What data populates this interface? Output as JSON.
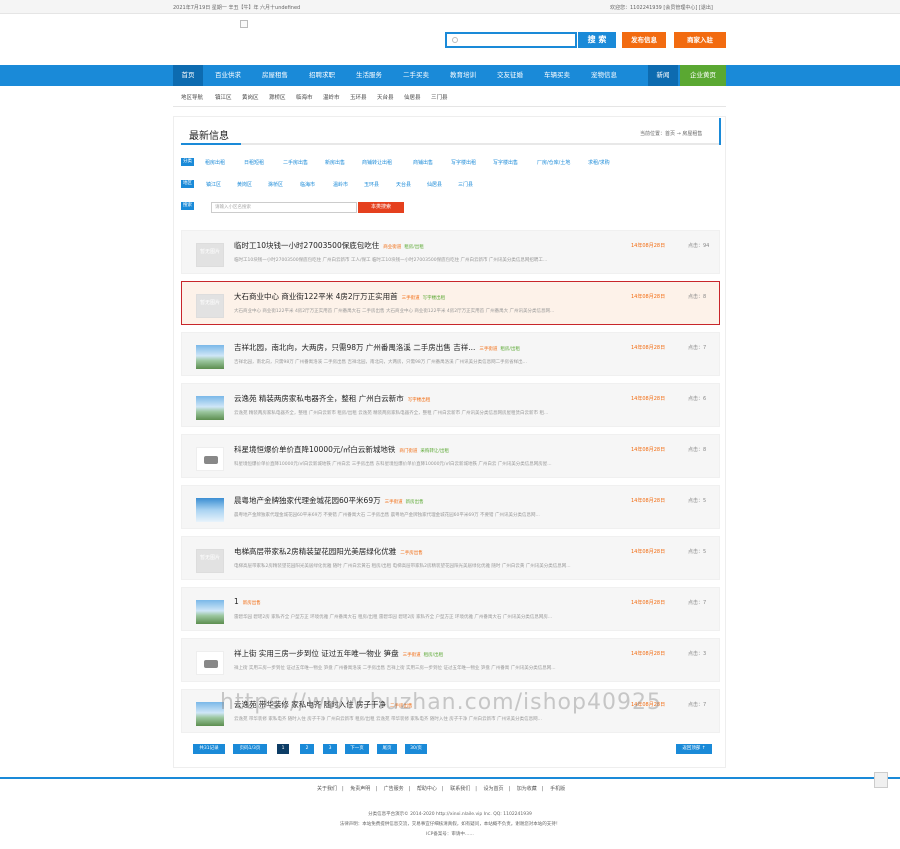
{
  "topbar": {
    "date_text": "2021年7月19日 星期一 辛丑【牛】年 六月十undefined",
    "user_text": "欢迎您：1102241939  [会员管理中心]  [退出]"
  },
  "search": {
    "placeholder": "",
    "button": "搜 索"
  },
  "actions": {
    "post": "发布信息",
    "merchant": "商家入驻"
  },
  "nav": {
    "items": [
      "首页",
      "百业供求",
      "房屋租售",
      "招聘求职",
      "生活服务",
      "二手买卖",
      "教育培训",
      "交友征婚",
      "车辆买卖",
      "宠物信息"
    ],
    "news": "新闻",
    "corp": "企业黄页"
  },
  "subnav": {
    "items": [
      "地区导航",
      "镇江区",
      "黄岗区",
      "滁桥区",
      "临海市",
      "温岭市",
      "玉环县",
      "天台县",
      "仙居县",
      "三门县"
    ]
  },
  "page": {
    "title": "最新信息",
    "breadcrumb": "当前位置：首页 → 房屋租售"
  },
  "filters": {
    "category_label": "分类",
    "categories": [
      "租房出租",
      "日租短租",
      "二手房出售",
      "新房出售",
      "商铺转让出租",
      "商铺出售",
      "写字楼出租",
      "写字楼出售",
      "厂房/仓库/土地",
      "求租/求购"
    ],
    "area_label": "地区",
    "areas": [
      "镇江区",
      "黄岗区",
      "滁桥区",
      "临海市",
      "温岭市",
      "玉环县",
      "天台县",
      "仙居县",
      "三门县"
    ],
    "search_label": "搜索",
    "keyword_placeholder": "请输入小区名搜索",
    "search_button": "本类搜索"
  },
  "listings": [
    {
      "title": "临时工10块钱一小时27003500保底包吃住",
      "tag1": "商业街道",
      "tag2": "租房/出租",
      "desc": "临时工10块钱一小时27003500保底包吃住 广州白云新市 工人/保工 临时工10块钱一小时27003500保底包吃住 广州白云新市 广州讯美分类信息网招聘工...",
      "date": "14年08月28日",
      "hits": "点击：94",
      "thumb": "noimg",
      "noimg_text": "暂无图片"
    },
    {
      "title": "大石商业中心 商业街122平米 4房2厅万正实用首",
      "tag1": "三手街道",
      "tag2": "写字楼出租",
      "desc": "大石商业中心 商业街122平米 4房2厅万正实用首 广州番禺大石 二手房出售 大石商业中心 商业街122平米 4房2厅万正实用首 广州番禺大 广州讯美分类信息网...",
      "date": "14年08月28日",
      "hits": "点击：8",
      "thumb": "noimg",
      "noimg_text": "暂无图片"
    },
    {
      "title": "吉祥北园，南北向，大两房，只需98万 广州番禺洛溪 二手房出售 吉祥...",
      "tag1": "三手街道",
      "tag2": "租房/出租",
      "desc": "吉祥北园，南北向，只需98万 广州番禺洛溪 二手房出售 吉祥北园，南北向，大两房，只需98万 广州番禺洛溪 广州讯美分类信息网二手房省样出...",
      "date": "14年08月28日",
      "hits": "点击：7",
      "thumb": "building"
    },
    {
      "title": "云逸苑 精装两房家私电器齐全，整租 广州白云新市",
      "tag1": "写字楼出租",
      "tag2": "",
      "desc": "云逸苑 精装两房家私电器齐全，整租 广州白云新市 租房/出租 云逸苑 精装两房家私电器齐全，整租 广州白云新市 广州讯美分类信息网房屋租赁白云新市 租...",
      "date": "14年08月28日",
      "hits": "点击：6",
      "thumb": "building"
    },
    {
      "title": "科星境恒爆价单价直降10000元/㎡白云新城地铁",
      "tag1": "商门街道",
      "tag2": "采购转让/出租",
      "desc": "科星境恒爆价单价直降10000元/㎡白云新城地铁 广州白云 三手房出售 东科星境恒爆价单价直降10000元/㎡白云新城地铁 广州白云 广州讯美分类信息网房屋...",
      "date": "14年08月28日",
      "hits": "点击：8",
      "thumb": "cam"
    },
    {
      "title": "晨粤地产金牌独家代理金城花园60平米69万",
      "tag1": "三手街道",
      "tag2": "新房出售",
      "desc": "晨粤地产金牌独家代理金城花园60平米69万 不要错 广州番禺大石 二手房出售 晨粤地产金牌独家代理金城花园60平米69万 不要错 广州讯美分类信息网...",
      "date": "14年08月28日",
      "hits": "点击：5",
      "thumb": "tower"
    },
    {
      "title": "电梯高层带家私2房精装望花园阳光美居绿化优雅",
      "tag1": "二手房出售",
      "tag2": "",
      "desc": "电梯高层带家私2房精装望花园阳光美居绿化优雅 随时 广州白云黄石 租房/出租 电梯高层带家私2房精装望花园阳光美居绿化优雅 随时 广州白云黄 广州讯美分类信息网...",
      "date": "14年08月28日",
      "hits": "点击：5",
      "thumb": "noimg",
      "noimg_text": "暂无图片"
    },
    {
      "title": "1",
      "tag1": "新房出售",
      "tag2": "",
      "desc": "雷碧华园 碧瑶2房 家私齐全 户型方正 环境优雅 广州番禺大石 租房/出租 雷碧华园 碧瑶2房 家私齐全 户型方正 环境优雅 广州番禺大石 广州讯美分类信息网房...",
      "date": "14年08月28日",
      "hits": "点击：7",
      "thumb": "building"
    },
    {
      "title": "祥上街 实用三房一步到位 证过五年唯一物业 笋盘",
      "tag1": "三手街道",
      "tag2": "租房/出租",
      "desc": "祥上街 实用三房一步到位 证过五年唯一物业 笋盘 广州番禺洛溪 二手房出售 吉祥上街 实用三房一步到位 证过五年唯一物业 笋盘 广州番禺 广州讯美分类信息网...",
      "date": "14年08月28日",
      "hits": "点击：3",
      "thumb": "cam"
    },
    {
      "title": "云逸苑 带华装修 家私电齐 随时入住 房子干净",
      "tag1": "二手房出售",
      "tag2": "",
      "desc": "云逸苑 带华装修 家私电齐 随时入住 房子干净 广州白云新市 租房/出租 云逸苑 带华装修 家私电齐 随时入住 房子干净 广州白云新市 广州讯美分类信息网...",
      "date": "14年08月28日",
      "hits": "点击：7",
      "thumb": "building"
    }
  ],
  "pagination": {
    "total": "共31记录",
    "pages": "页码1/3页",
    "current": "1",
    "p2": "2",
    "p3": "3",
    "next": "下一页",
    "last": "尾页",
    "per": "30/页",
    "back_top": "返回顶部 ↑"
  },
  "footer": {
    "links": [
      "关于我们",
      "免责声明",
      "广告服务",
      "帮助中心",
      "联系我们",
      "设为首页",
      "加为收藏",
      "手机版"
    ],
    "copyright": "分类信息平台演示© 2014-2020 http://xinxi.nlaile.vip Inc. QQ: 1102241939",
    "disclaimer": "法律声明：本站免费提供信息交流，交易事宜仔细核清真假，如有疑问，本站概不负责。谢谢您对本站的支持！",
    "icp": "ICP备案号：审请中……"
  },
  "watermark": "https://www.huzhan.com/ishop40925"
}
